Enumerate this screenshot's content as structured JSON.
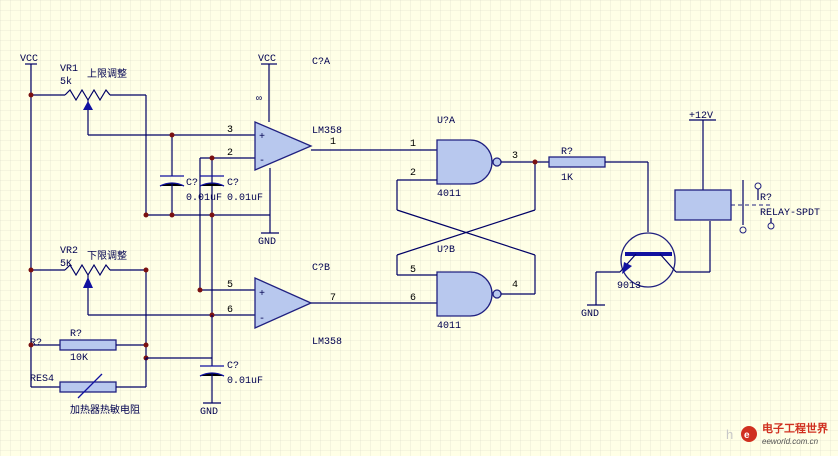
{
  "labels": {
    "vcc1": "VCC",
    "vcc2": "VCC",
    "vr1": "VR1",
    "vr1_val": "5k",
    "vr1_desc": "上限调整",
    "vr2": "VR2",
    "vr2_val": "5K",
    "vr2_desc": "下限调整",
    "inf": "∞",
    "ca": "C?A",
    "cb": "C?B",
    "lm358a": "LM358",
    "lm358b": "LM358",
    "c1": "C?",
    "c1_val": "0.01uF",
    "c2": "C?",
    "c2_val": "0.01uF",
    "c3": "C?",
    "c3_val": "0.01uF",
    "gnd1": "GND",
    "gnd2": "GND",
    "gnd3": "GND",
    "r1": "R?",
    "r1_val": "10K",
    "res4": "RES4",
    "heater": "加热器热敏电阻",
    "ua": "U?A",
    "ub": "U?B",
    "u4011a": "4011",
    "u4011b": "4011",
    "r2": "R?",
    "r2_val": "1K",
    "v12": "+12V",
    "transistor": "9013",
    "relay": "R?",
    "relay_val": "RELAY-SPDT",
    "watermark": "电子工程世界",
    "watermark_url": "eeworld.com.cn",
    "watermark_prefix": "h"
  },
  "pins": {
    "p3a": "3",
    "p2a": "2",
    "p1a": "1",
    "p5b": "5",
    "p6b": "6",
    "p7b": "7",
    "g1": "1",
    "g2": "2",
    "g3": "3",
    "g5": "5",
    "g6": "6",
    "g4": "4"
  }
}
